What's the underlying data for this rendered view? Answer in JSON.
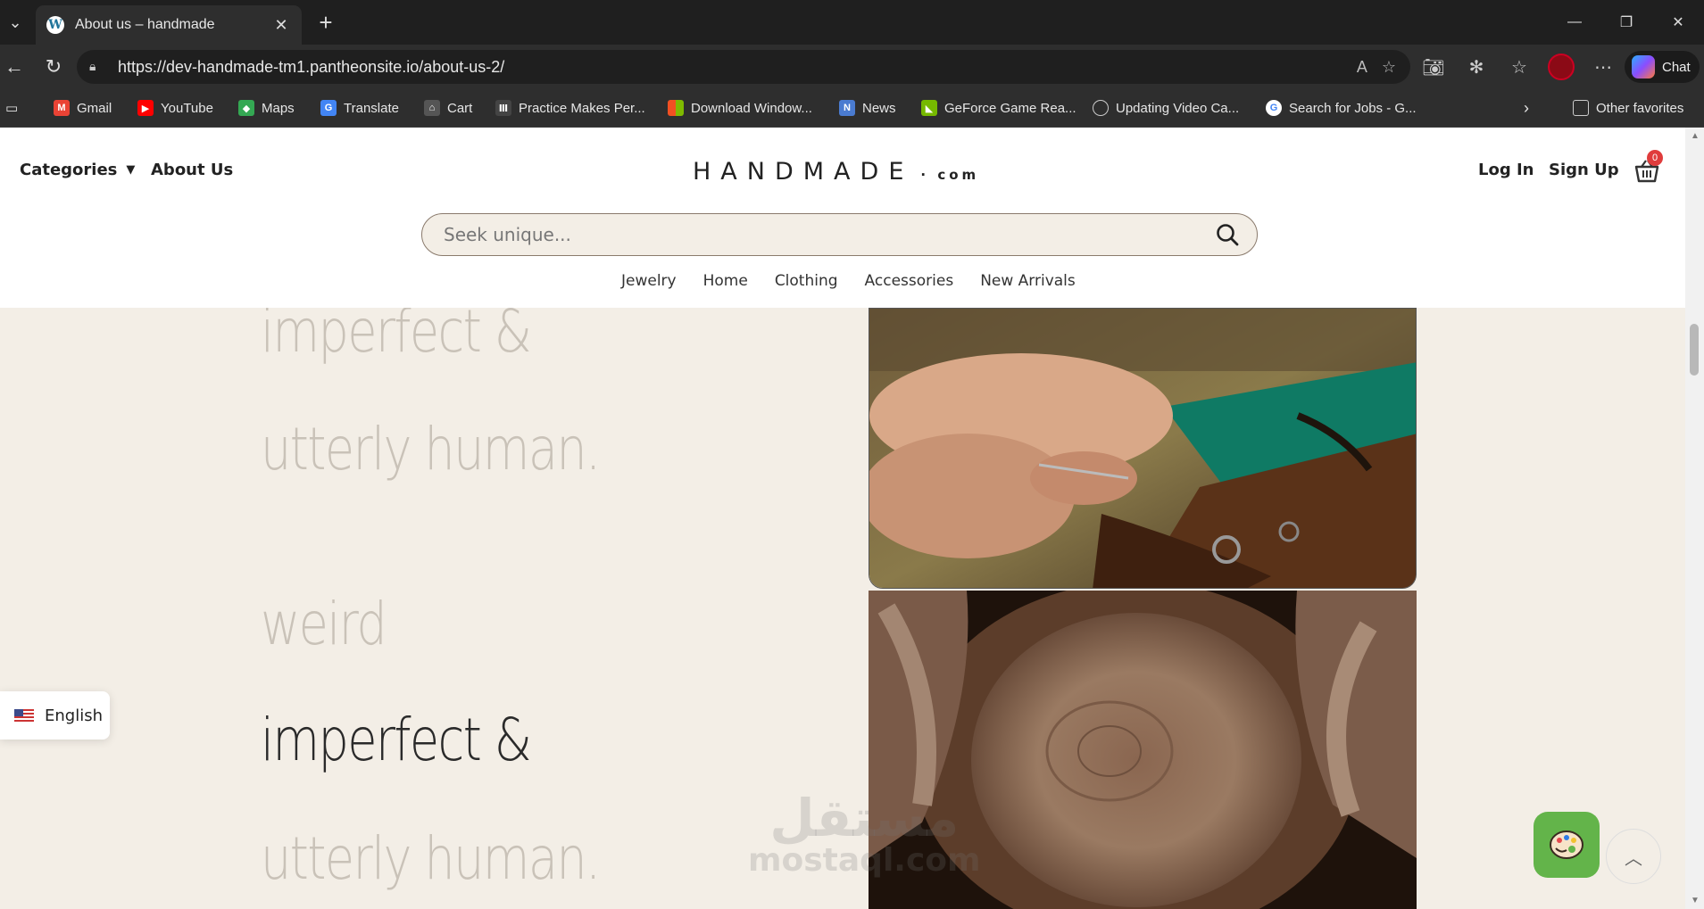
{
  "browser": {
    "tab_title": "About us – handmade",
    "url": "https://dev-handmade-tm1.pantheonsite.io/about-us-2/",
    "chat_label": "Chat",
    "bookmarks": [
      {
        "label": "Gmail",
        "icon": "gmail-icon",
        "color": "#ea4335"
      },
      {
        "label": "YouTube",
        "icon": "youtube-icon",
        "color": "#ff0000"
      },
      {
        "label": "Maps",
        "icon": "maps-icon",
        "color": "#34a853"
      },
      {
        "label": "Translate",
        "icon": "translate-icon",
        "color": "#4285f4"
      },
      {
        "label": "Cart",
        "icon": "cart-icon",
        "color": "#888888"
      },
      {
        "label": "Practice Makes Per...",
        "icon": "library-icon",
        "color": "#dddddd"
      },
      {
        "label": "Download Window...",
        "icon": "windows-icon",
        "color": "#f25022"
      },
      {
        "label": "News",
        "icon": "news-icon",
        "color": "#4a7bd0"
      },
      {
        "label": "GeForce Game Rea...",
        "icon": "nvidia-icon",
        "color": "#76b900"
      },
      {
        "label": "Updating Video Ca...",
        "icon": "globe-icon",
        "color": "#cccccc"
      },
      {
        "label": "Search for Jobs - G...",
        "icon": "google-icon",
        "color": "#4285f4"
      }
    ],
    "other_favorites": "Other favorites"
  },
  "header": {
    "categories_label": "Categories",
    "about_label": "About Us",
    "logo_main": "HANDMADE",
    "logo_suffix": "com",
    "login_label": "Log In",
    "signup_label": "Sign Up",
    "cart_count": "0",
    "search_placeholder": "Seek unique...",
    "nav": [
      "Jewelry",
      "Home",
      "Clothing",
      "Accessories",
      "New Arrivals"
    ]
  },
  "hero": {
    "line1": "imperfect &",
    "line2": "utterly human.",
    "line3": "weird",
    "line4": "imperfect &",
    "line5": "utterly human."
  },
  "language": {
    "label": "English"
  },
  "watermark": {
    "arabic": "مستقل",
    "latin": "mostaql.com"
  },
  "colors": {
    "page_bg": "#f3eee6",
    "accent_green": "#63b44a",
    "badge_red": "#e03c3c"
  }
}
